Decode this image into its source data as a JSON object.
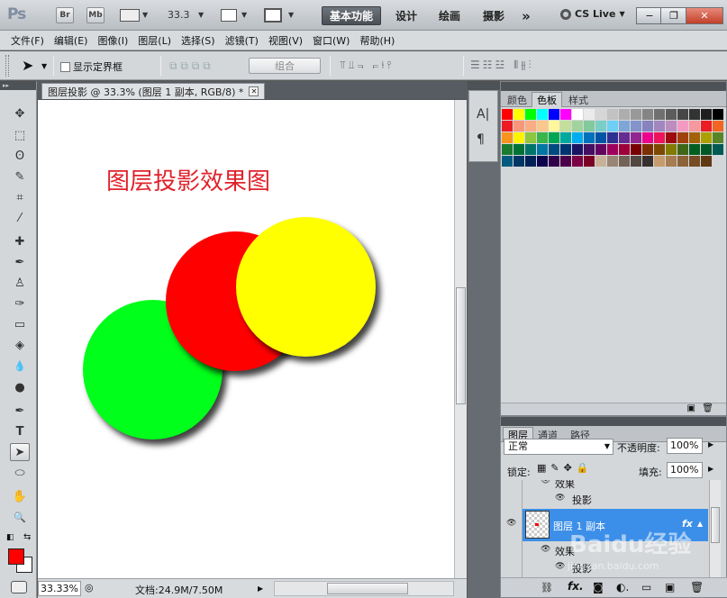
{
  "app": {
    "logo": "Ps",
    "bridge_label": "Br",
    "minibridge_label": "Mb",
    "zoom_select": "33.3",
    "workspaces": [
      "基本功能",
      "设计",
      "绘画",
      "摄影"
    ],
    "more": "»",
    "cs_live": "CS Live",
    "window_controls": {
      "minimize": "−",
      "restore": "❐",
      "close": "✕"
    }
  },
  "menu": [
    "文件(F)",
    "编辑(E)",
    "图像(I)",
    "图层(L)",
    "选择(S)",
    "滤镜(T)",
    "视图(V)",
    "窗口(W)",
    "帮助(H)"
  ],
  "options": {
    "show_bounds_label": "显示定界框",
    "group_label": "组合"
  },
  "tools": {
    "icons": [
      "move-icon",
      "marquee-icon",
      "lasso-icon",
      "quick-select-icon",
      "crop-icon",
      "eyedropper-icon",
      "healing-icon",
      "brush-icon",
      "stamp-icon",
      "history-brush-icon",
      "eraser-icon",
      "paint-bucket-icon",
      "blur-icon",
      "dodge-icon",
      "pen-icon",
      "type-icon",
      "path-select-icon",
      "ellipse-icon",
      "hand-icon",
      "zoom-icon"
    ],
    "glyphs": [
      "✥",
      "⬚",
      "ʘ",
      "✎",
      "⌗",
      "⁄",
      "✚",
      "✒",
      "♙",
      "✑",
      "▭",
      "◈",
      "💧",
      "●",
      "✒",
      "T",
      "➤",
      "⬭",
      "✋",
      "🔍"
    ],
    "foreground": "#ff0000",
    "background": "#ffffff"
  },
  "document": {
    "tab_title": "图层投影 @ 33.3% (图层 1 副本, RGB/8) *",
    "canvas_title": "图层投影效果图",
    "zoom": "33.33%",
    "doc_size": "文档:24.9M/7.50M",
    "circle_colors": {
      "green": "#00ff1a",
      "red": "#ff0000",
      "yellow": "#ffff00"
    }
  },
  "side_dock": {
    "char_icon": "A|",
    "para_icon": "¶"
  },
  "swatches_panel": {
    "tabs": [
      "颜色",
      "色板",
      "样式"
    ],
    "active_tab": "色板"
  },
  "layers_panel": {
    "tabs": [
      "图层",
      "通道",
      "路径"
    ],
    "blend_mode": "正常",
    "opacity_label": "不透明度:",
    "opacity_value": "100%",
    "lock_label": "锁定:",
    "fill_label": "填充:",
    "fill_value": "100%",
    "effects_label": "效果",
    "shadow_label": "投影",
    "selected_layer": "图层 1 副本",
    "fx": "fx",
    "effects_label_2": "效果",
    "shadow_label_2": "投影"
  },
  "watermark": {
    "text": "Baidu经验",
    "url": "jingyan.baidu.com"
  }
}
